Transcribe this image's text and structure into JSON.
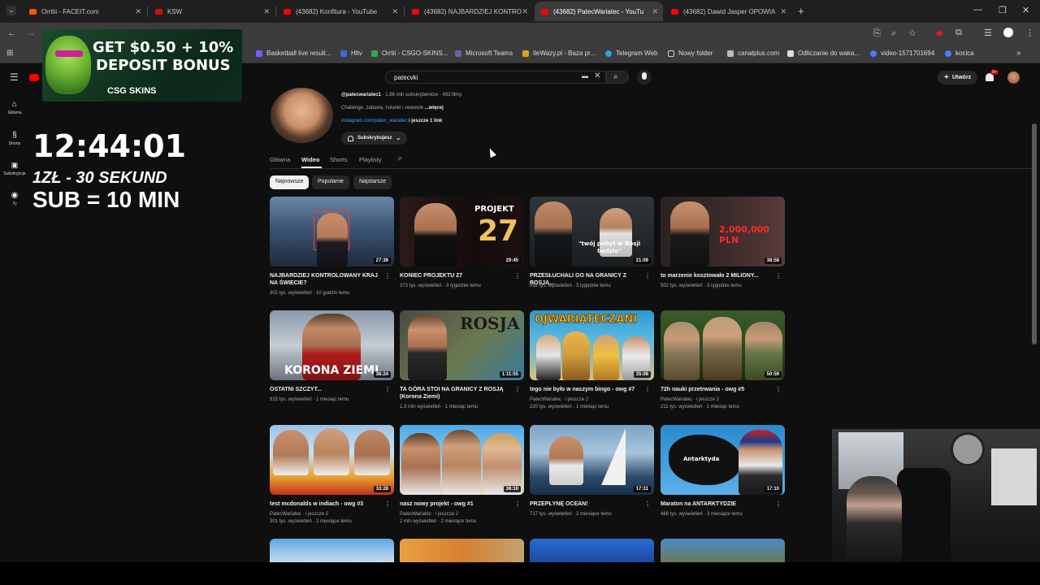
{
  "browser": {
    "tabs": [
      {
        "label": "Orrtiii - FACEIT.com",
        "color": "#ff5500"
      },
      {
        "label": "KSW",
        "color": "#d01010"
      },
      {
        "label": "(43682) Konfitura - YouTube",
        "color": "#ff0000"
      },
      {
        "label": "(43682) NAJBARDZIEJ KONTRO",
        "color": "#ff0000"
      },
      {
        "label": "(43682) PatecWariatec - YouTu",
        "color": "#ff0000"
      },
      {
        "label": "(43682) Dawid Jasper OPOWIA",
        "color": "#ff0000"
      }
    ],
    "bookmarks": [
      {
        "label": "Basketball live result...",
        "color": "#7b5cff"
      },
      {
        "label": "Hltv",
        "color": "#3a6bd6"
      },
      {
        "label": "Orrtii - CSGO-SKINS...",
        "color": "#2fa84f"
      },
      {
        "label": "Microsoft Teams",
        "color": "#6264a7"
      },
      {
        "label": "IleWazy.pl - Baza pr...",
        "color": "#e0a020"
      },
      {
        "label": "Telegram Web",
        "color": "#2aa3e0"
      },
      {
        "label": "Nowy folder",
        "color": "#cfcfcf"
      },
      {
        "label": "canalplus.com",
        "color": "#bbbbbb"
      },
      {
        "label": "Odliczanie do waka...",
        "color": "#dddddd"
      },
      {
        "label": "video-1571701694",
        "color": "#4a7cff"
      },
      {
        "label": "kocica",
        "color": "#4a7cff"
      }
    ]
  },
  "yt": {
    "search_value": "patecvki",
    "create_label": "Utwórz",
    "notifications": "9+",
    "sidebar": [
      {
        "label": "Główna",
        "icon": "home-icon"
      },
      {
        "label": "Shorts",
        "icon": "shorts-icon"
      },
      {
        "label": "Subskrypcje",
        "icon": "subscriptions-icon"
      },
      {
        "label": "Ty",
        "icon": "you-icon"
      }
    ],
    "channel": {
      "handle": "@patecwariatec1",
      "stats": "· 1,86 mln subskrybentów · 493 filmy",
      "desc": "Challenge, zabawa, hulanki i swawole",
      "more": "...więcej",
      "link": "instagram.com/patec_wariatec",
      "link_more": " i jeszcze 1 link",
      "subscribed": "Subskrybujesz"
    },
    "tabs": [
      "Główna",
      "Wideo",
      "Shorts",
      "Playlisty"
    ],
    "active_tab": "Wideo",
    "chips": [
      "Najnowsze",
      "Popularne",
      "Najstarsze"
    ],
    "videos": [
      {
        "title": "NAJBARDZIEJ KONTROLOWANY KRAJ NA ŚWIECIE?",
        "meta1": "302 tys. wyświetleń · 10 godzin temu",
        "meta2": "",
        "duration": "27:36"
      },
      {
        "title": "KONIEC PROJEKTU 27",
        "meta1": "373 tys. wyświetleń · 3 tygodnie temu",
        "meta2": "",
        "duration": "29:45"
      },
      {
        "title": "PRZESŁUCHALI GO NA GRANICY Z ROSJĄ...",
        "meta1": "592 tys. wyświetleń · 3 tygodnie temu",
        "meta2": "",
        "duration": "21:09"
      },
      {
        "title": "to marzenie kosztowało 2 MILIONY...",
        "meta1": "502 tys. wyświetleń · 3 tygodnie temu",
        "meta2": "",
        "duration": "38:58"
      },
      {
        "title": "OSTATNI SZCZYT...",
        "meta1": "915 tys. wyświetleń · 1 miesiąc temu",
        "meta2": "",
        "duration": "38:24"
      },
      {
        "title": "TA GÓRA STOI NA GRANICY Z ROSJĄ (Korona Ziemi)",
        "meta1": "1,3 mln wyświetleń · 1 miesiąc temu",
        "meta2": "",
        "duration": "1:11:55"
      },
      {
        "title": "tego nie było w naszym bingo - owg #7",
        "meta1": "PatecWariatec · i jeszcze 2",
        "meta2": "220 tys. wyświetleń · 1 miesiąc temu",
        "duration": "35:08"
      },
      {
        "title": "72h nauki przetrwania - owg #5",
        "meta1": "PatecWariatec · i jeszcze 2",
        "meta2": "211 tys. wyświetleń · 1 miesiąc temu",
        "duration": "50:59"
      },
      {
        "title": "test mcdonalds w indiach - owg #3",
        "meta1": "PatecWariatec · i jeszcze 2",
        "meta2": "301 tys. wyświetleń · 2 miesiące temu",
        "duration": "33:28"
      },
      {
        "title": "nasz nowy projekt - owg #1",
        "meta1": "PatecWariatec · i jeszcze 2",
        "meta2": "2 mln wyświetleń · 2 miesiące temu",
        "duration": "36:10"
      },
      {
        "title": "PRZEPŁYNĘ OCEAN!",
        "meta1": "717 tys. wyświetleń · 2 miesiące temu",
        "meta2": "",
        "duration": "17:31"
      },
      {
        "title": "Maraton na ANTARKTYDZIE",
        "meta1": "488 tys. wyświetleń · 3 miesiące temu",
        "meta2": "",
        "duration": "17:10"
      }
    ],
    "thumb_text": {
      "projekt": "PROJEKT",
      "num27": "27",
      "pobyt": "\"twój pobyt w Rosji będzie\"",
      "money": "2,000,000 PLN",
      "korona": "KORONA ZIEMI",
      "rosja": "ROSJA",
      "ojwariateczani": "OJWARIATECZANI",
      "antarktyda": "Antarktyda"
    }
  },
  "overlay": {
    "ad_line1": "GET $0.50 + 10%",
    "ad_line2": "DEPOSIT BONUS",
    "ad_brand": "CSG SKINS",
    "clock": "12:44:01",
    "promo1": "1ZŁ - 30 SEKUND",
    "promo2": "SUB = 10 MIN"
  }
}
